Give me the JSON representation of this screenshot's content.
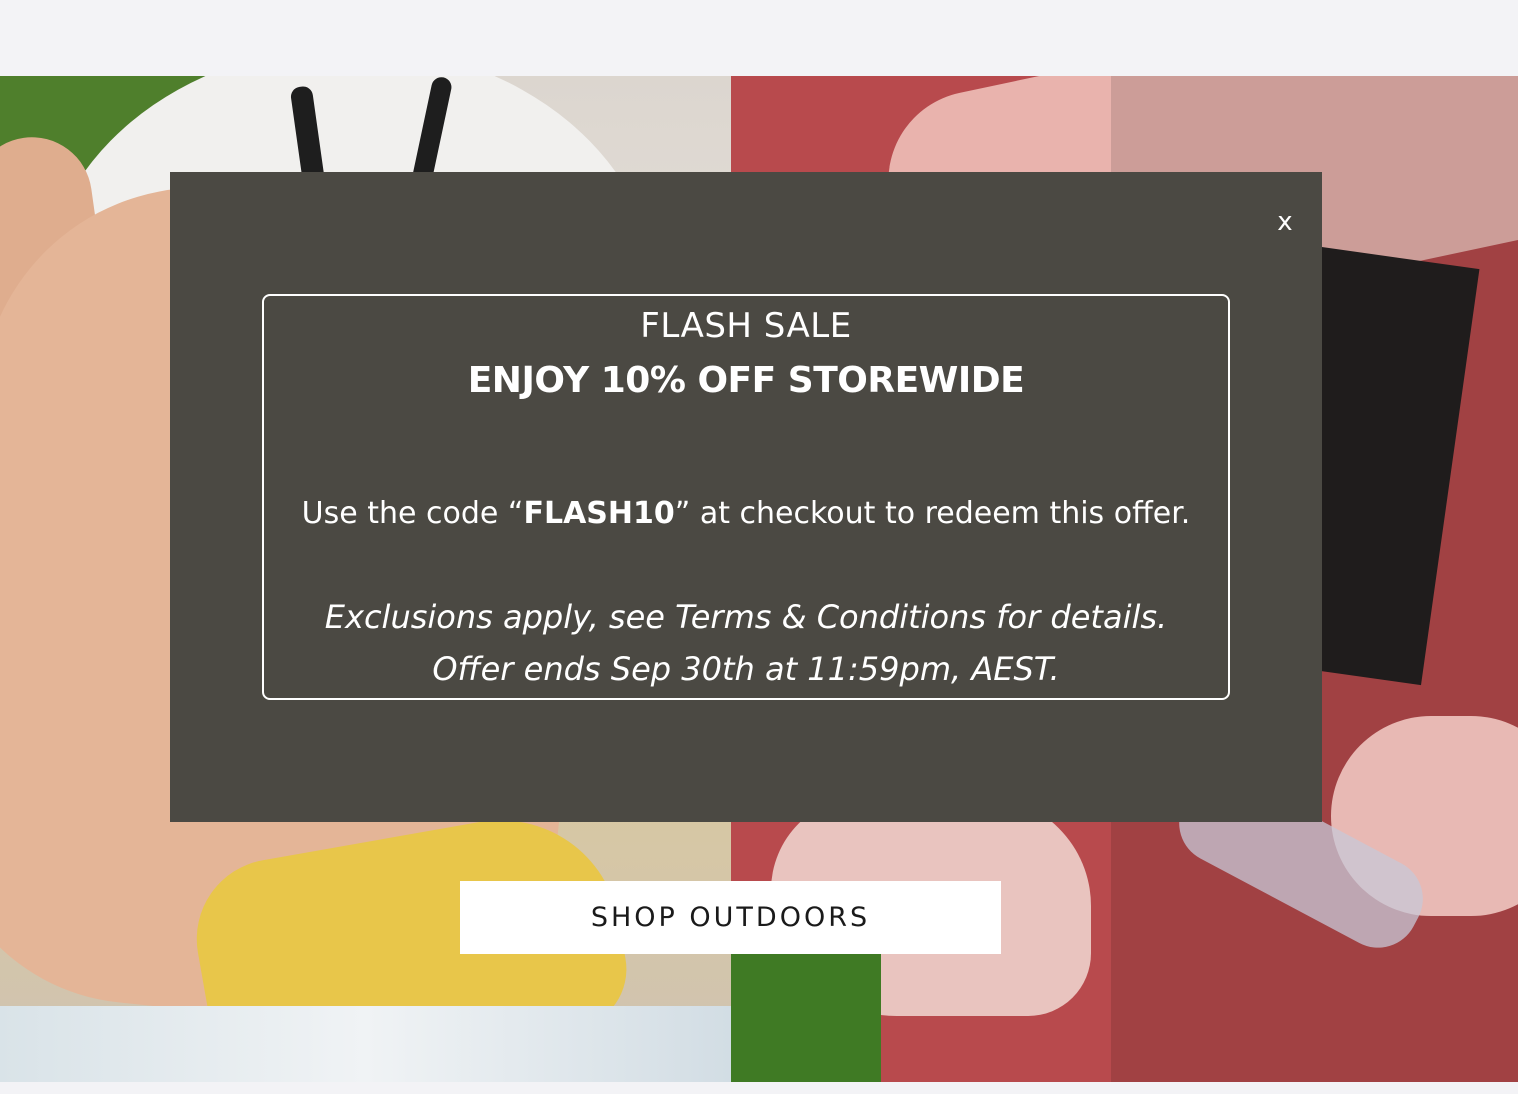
{
  "hero": {
    "cta_label": "SHOP OUTDOORS"
  },
  "modal": {
    "close_label": "x",
    "title": "FLASH SALE",
    "subtitle": "ENJOY 10% OFF STOREWIDE",
    "code_prefix": "Use the code “",
    "code": "FLASH10",
    "code_suffix": "” at checkout to redeem this offer.",
    "exclusions": "Exclusions apply, see Terms & Conditions for details.",
    "offer_end": "Offer ends Sep 30th at 11:59pm, AEST."
  },
  "colors": {
    "modal_bg": "#4b4943",
    "page_bg": "#f3f3f6"
  }
}
